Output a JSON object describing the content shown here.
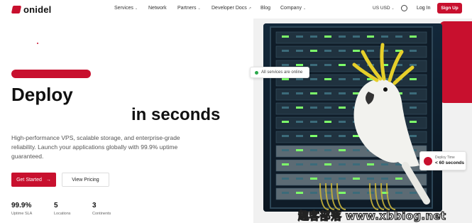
{
  "brand": {
    "name": "onidel",
    "color": "#c8102e"
  },
  "nav": {
    "items": [
      {
        "label": "Services",
        "dropdown": true
      },
      {
        "label": "Network",
        "dropdown": false
      },
      {
        "label": "Partners",
        "dropdown": true
      },
      {
        "label": "Developer Docs",
        "external": true
      },
      {
        "label": "Blog",
        "dropdown": false
      },
      {
        "label": "Company",
        "dropdown": true
      }
    ],
    "currency": "US USD",
    "theme_icon": "sun-icon",
    "login": "Log In",
    "signup": "Sign Up"
  },
  "hero": {
    "title_line1": "Deploy",
    "title_line2": "in seconds",
    "description": "High-performance VPS, scalable storage, and enterprise-grade reliability. Launch your applications globally with 99.9% uptime guaranteed.",
    "cta_primary": "Get Started",
    "cta_primary_icon": "arrow-right-icon",
    "cta_secondary": "View Pricing"
  },
  "stats": [
    {
      "value": "99.9%",
      "label": "Uptime SLA"
    },
    {
      "value": "5",
      "label": "Locations"
    },
    {
      "value": "3",
      "label": "Continents"
    }
  ],
  "badges": {
    "status": "All services are online",
    "deploy_label": "Deploy Time",
    "deploy_value": "< 60 seconds"
  },
  "watermark": "趣客部落 www.xbbiog.net"
}
